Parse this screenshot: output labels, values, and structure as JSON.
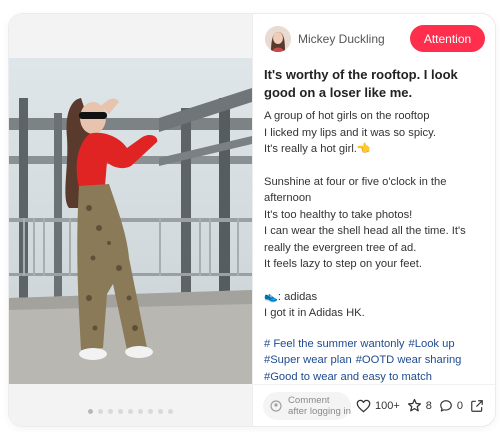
{
  "author": {
    "name": "Mickey Duckling"
  },
  "follow_button": "Attention",
  "post": {
    "title": "It's worthy of the rooftop. I look good on a loser like me.",
    "body_lines_1": [
      "A group of hot girls on the rooftop",
      "I licked my lips and it was so spicy.",
      "It's really a hot girl.👈"
    ],
    "body_lines_2": [
      "Sunshine at four or five o'clock in the afternoon",
      "It's too healthy to take photos!",
      "I can wear the shell head all the time. It's really the evergreen tree of ad.",
      "It feels lazy to step on your feet."
    ],
    "body_lines_3": [
      "👟: adidas",
      "I got it in Adidas HK."
    ],
    "tags": [
      "# Feel the summer wantonly",
      "#Look up",
      "#Super wear plan",
      "#OOTD wear sharing",
      "#Good to wear and easy to match"
    ]
  },
  "footer": {
    "comment_placeholder": "Comment after logging in",
    "likes": "100+",
    "stars": "8",
    "comments": "0"
  },
  "carousel": {
    "count": 9,
    "active_index": 0
  },
  "colors": {
    "accent": "#ff2e4d",
    "tag": "#1f4b8f"
  }
}
